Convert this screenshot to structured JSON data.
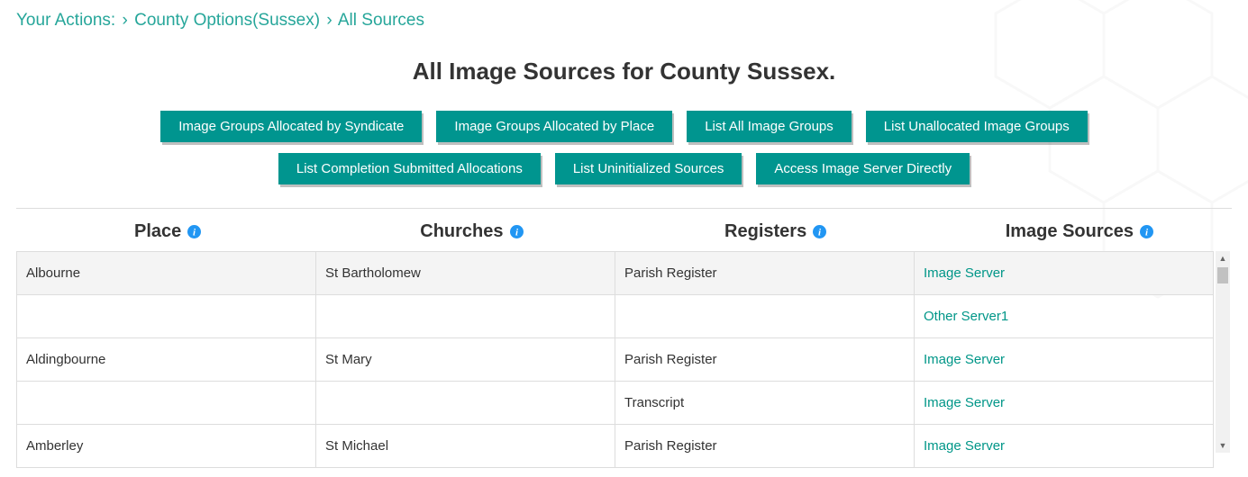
{
  "breadcrumb": {
    "root": "Your Actions:",
    "items": [
      "County Options(Sussex)",
      "All Sources"
    ]
  },
  "title": "All Image Sources for County Sussex.",
  "buttons": [
    "Image Groups Allocated by Syndicate",
    "Image Groups Allocated by Place",
    "List All Image Groups",
    "List Unallocated Image Groups",
    "List Completion Submitted Allocations",
    "List Uninitialized Sources",
    "Access Image Server Directly"
  ],
  "columns": [
    "Place",
    "Churches",
    "Registers",
    "Image Sources"
  ],
  "rows": [
    {
      "shaded": true,
      "place": "Albourne",
      "church": "St Bartholomew",
      "register": "Parish Register",
      "source": "Image Server"
    },
    {
      "shaded": false,
      "place": "",
      "church": "",
      "register": "",
      "source": "Other Server1"
    },
    {
      "shaded": false,
      "place": "Aldingbourne",
      "church": "St Mary",
      "register": "Parish Register",
      "source": "Image Server"
    },
    {
      "shaded": false,
      "place": "",
      "church": "",
      "register": "Transcript",
      "source": "Image Server"
    },
    {
      "shaded": false,
      "place": "Amberley",
      "church": "St Michael",
      "register": "Parish Register",
      "source": "Image Server"
    }
  ]
}
